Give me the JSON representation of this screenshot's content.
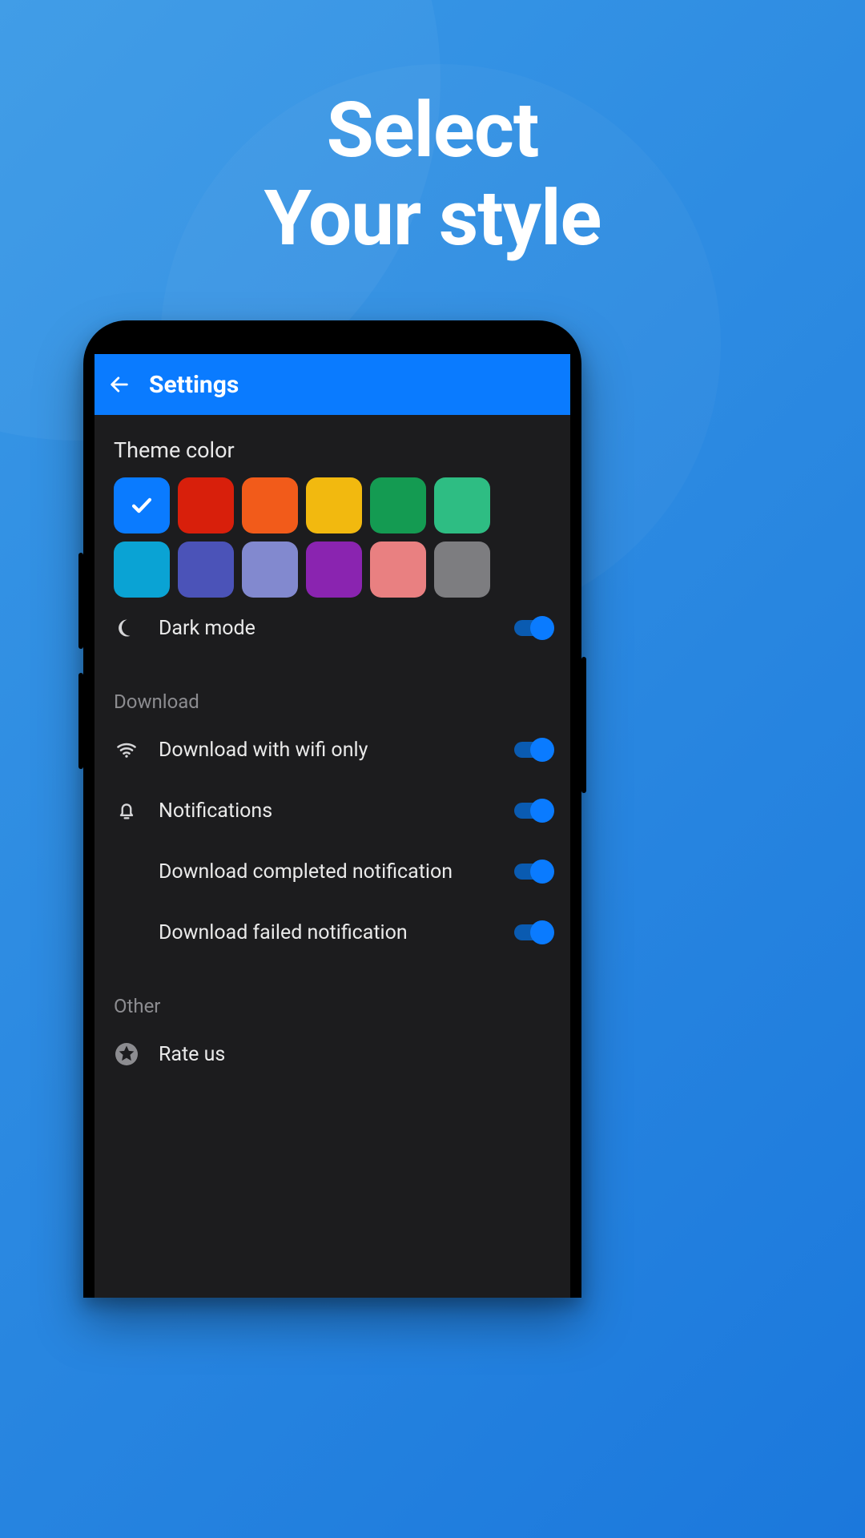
{
  "promo": {
    "headline_line1": "Select",
    "headline_line2": "Your style"
  },
  "appbar": {
    "title": "Settings"
  },
  "theme": {
    "section_label": "Theme color",
    "selected_index": 0,
    "colors": [
      "#0a7bff",
      "#d81f0b",
      "#f25b1a",
      "#f2b90f",
      "#149b52",
      "#2ebd83",
      "#0aa3d4",
      "#4b53b8",
      "#8289cf",
      "#8a24b0",
      "#e98081",
      "#7d7d80"
    ]
  },
  "settings": {
    "dark_mode": {
      "label": "Dark mode",
      "value": true
    },
    "download_header": "Download",
    "wifi_only": {
      "label": "Download with wifi only",
      "value": true
    },
    "notifications": {
      "label": "Notifications",
      "value": true
    },
    "completed_notif": {
      "label": "Download completed notification",
      "value": true
    },
    "failed_notif": {
      "label": "Download failed notification",
      "value": true
    },
    "other_header": "Other",
    "rate_us": {
      "label": "Rate us"
    }
  }
}
